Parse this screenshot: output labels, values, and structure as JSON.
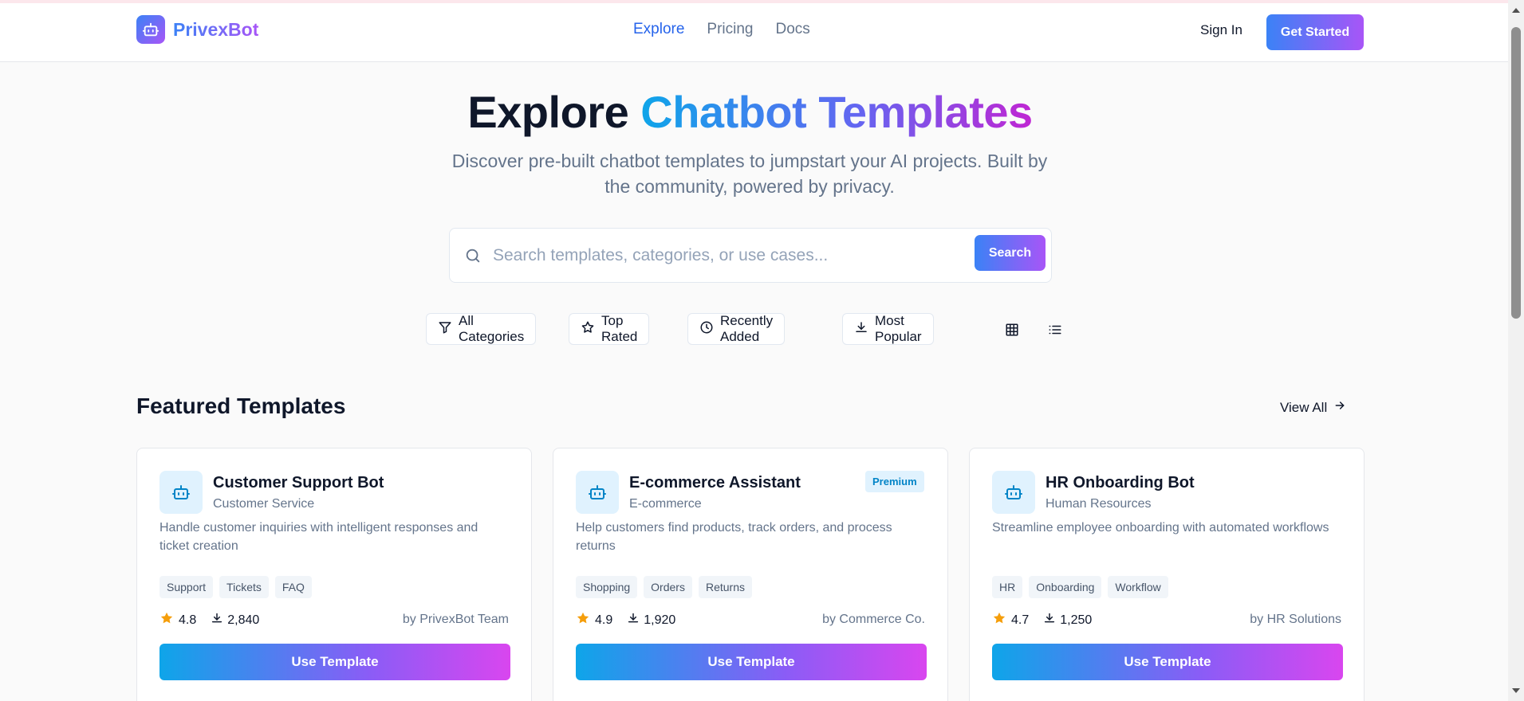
{
  "brand": {
    "name": "PrivexBot",
    "logo_icon": "robot-icon"
  },
  "nav": {
    "links": [
      {
        "label": "Explore",
        "active": true
      },
      {
        "label": "Pricing",
        "active": false
      },
      {
        "label": "Docs",
        "active": false
      }
    ],
    "sign_in": "Sign In",
    "get_started": "Get Started"
  },
  "hero": {
    "title_plain": "Explore",
    "title_gradient": "Chatbot Templates",
    "subtitle": "Discover pre-built chatbot templates to jumpstart your AI projects. Built by the community, powered by privacy."
  },
  "search": {
    "placeholder": "Search templates, categories, or use cases...",
    "value": "",
    "button": "Search"
  },
  "filters": [
    {
      "label": "All Categories",
      "icon": "filter-icon"
    },
    {
      "label": "Top Rated",
      "icon": "star-outline-icon"
    },
    {
      "label": "Recently Added",
      "icon": "clock-icon"
    },
    {
      "label": "Most Popular",
      "icon": "download-icon"
    }
  ],
  "view_toggle": [
    "grid-view-icon",
    "list-view-icon"
  ],
  "featured": {
    "title": "Featured Templates",
    "view_all": "View All",
    "cards": [
      {
        "title": "Customer Support Bot",
        "category": "Customer Service",
        "premium": "",
        "description": "Handle customer inquiries with intelligent responses and ticket creation",
        "tags": [
          "Support",
          "Tickets",
          "FAQ"
        ],
        "rating": "4.8",
        "downloads": "2,840",
        "author": "by PrivexBot Team",
        "button": "Use Template"
      },
      {
        "title": "E-commerce Assistant",
        "category": "E-commerce",
        "premium": "Premium",
        "description": "Help customers find products, track orders, and process returns",
        "tags": [
          "Shopping",
          "Orders",
          "Returns"
        ],
        "rating": "4.9",
        "downloads": "1,920",
        "author": "by Commerce Co.",
        "button": "Use Template"
      },
      {
        "title": "HR Onboarding Bot",
        "category": "Human Resources",
        "premium": "",
        "description": "Streamline employee onboarding with automated workflows",
        "tags": [
          "HR",
          "Onboarding",
          "Workflow"
        ],
        "rating": "4.7",
        "downloads": "1,250",
        "author": "by HR Solutions",
        "button": "Use Template"
      }
    ]
  },
  "colors": {
    "primary_blue": "#3b82f6",
    "accent_purple": "#a855f7",
    "active_link": "#2563eb",
    "muted_text": "#64748b",
    "star": "#f59e0b"
  }
}
